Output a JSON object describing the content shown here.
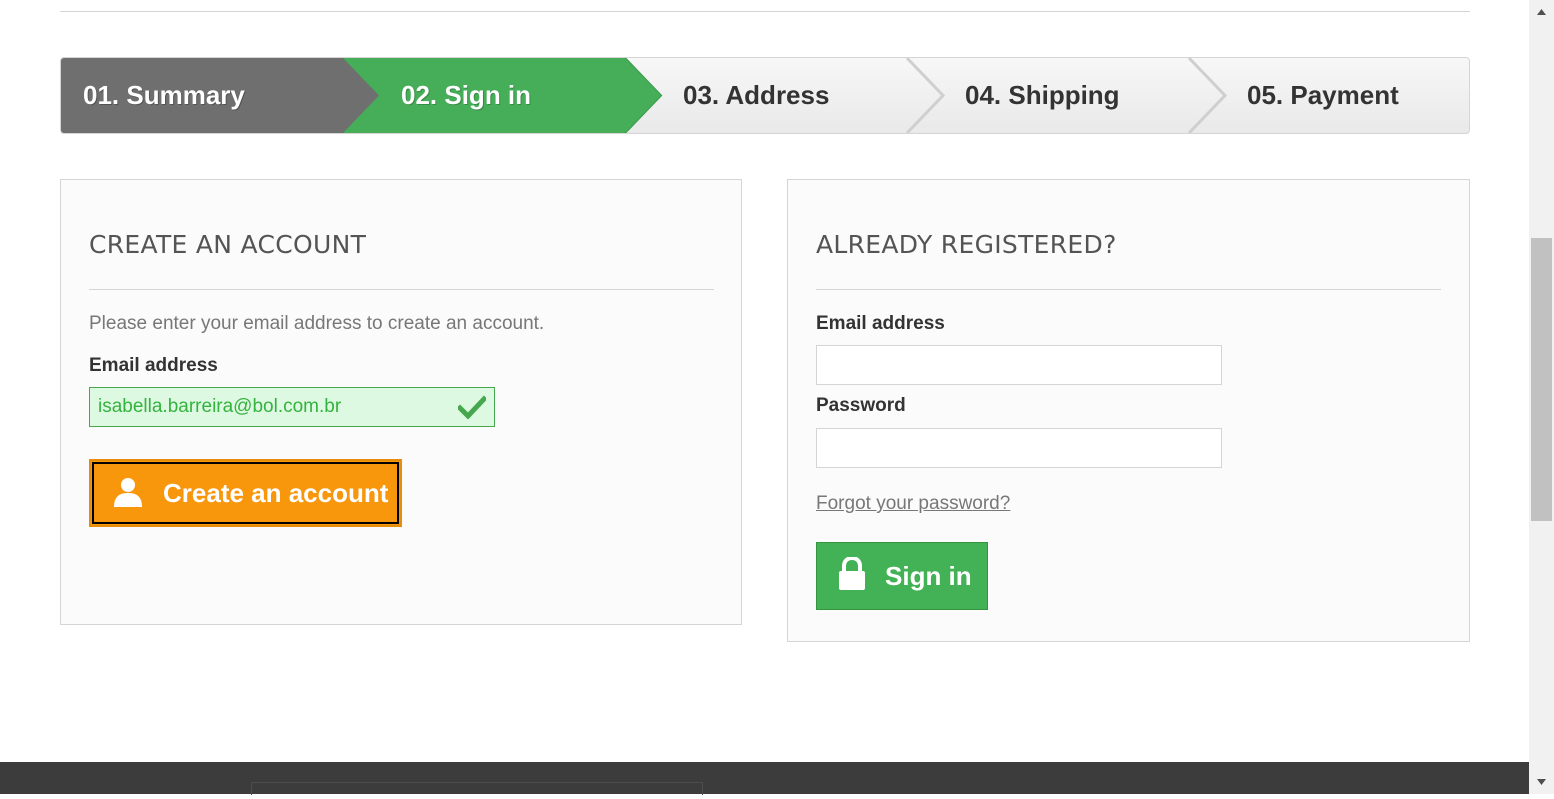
{
  "steps": [
    {
      "label": "01. Summary",
      "state": "done"
    },
    {
      "label": "02. Sign in",
      "state": "current"
    },
    {
      "label": "03. Address",
      "state": "todo"
    },
    {
      "label": "04. Shipping",
      "state": "todo"
    },
    {
      "label": "05. Payment",
      "state": "todo"
    }
  ],
  "create_account": {
    "heading": "CREATE AN ACCOUNT",
    "intro": "Please enter your email address to create an account.",
    "email_label": "Email address",
    "email_value": "isabella.barreira@bol.com.br",
    "button_label": "Create an account"
  },
  "login": {
    "heading": "ALREADY REGISTERED?",
    "email_label": "Email address",
    "email_value": "",
    "password_label": "Password",
    "password_value": "",
    "forgot_label": "Forgot your password?",
    "button_label": "Sign in"
  },
  "colors": {
    "done": "#6f6f6f",
    "current": "#46ad58",
    "create_button": "#f8960c",
    "signin_button": "#43b155",
    "valid_bg": "#ddf9e1",
    "footer": "#3c3c3c"
  },
  "icons": {
    "valid_check": "check-icon",
    "create_button": "user-icon",
    "signin_button": "lock-icon",
    "scroll_up": "arrow-up-icon",
    "scroll_down": "arrow-down-icon"
  }
}
